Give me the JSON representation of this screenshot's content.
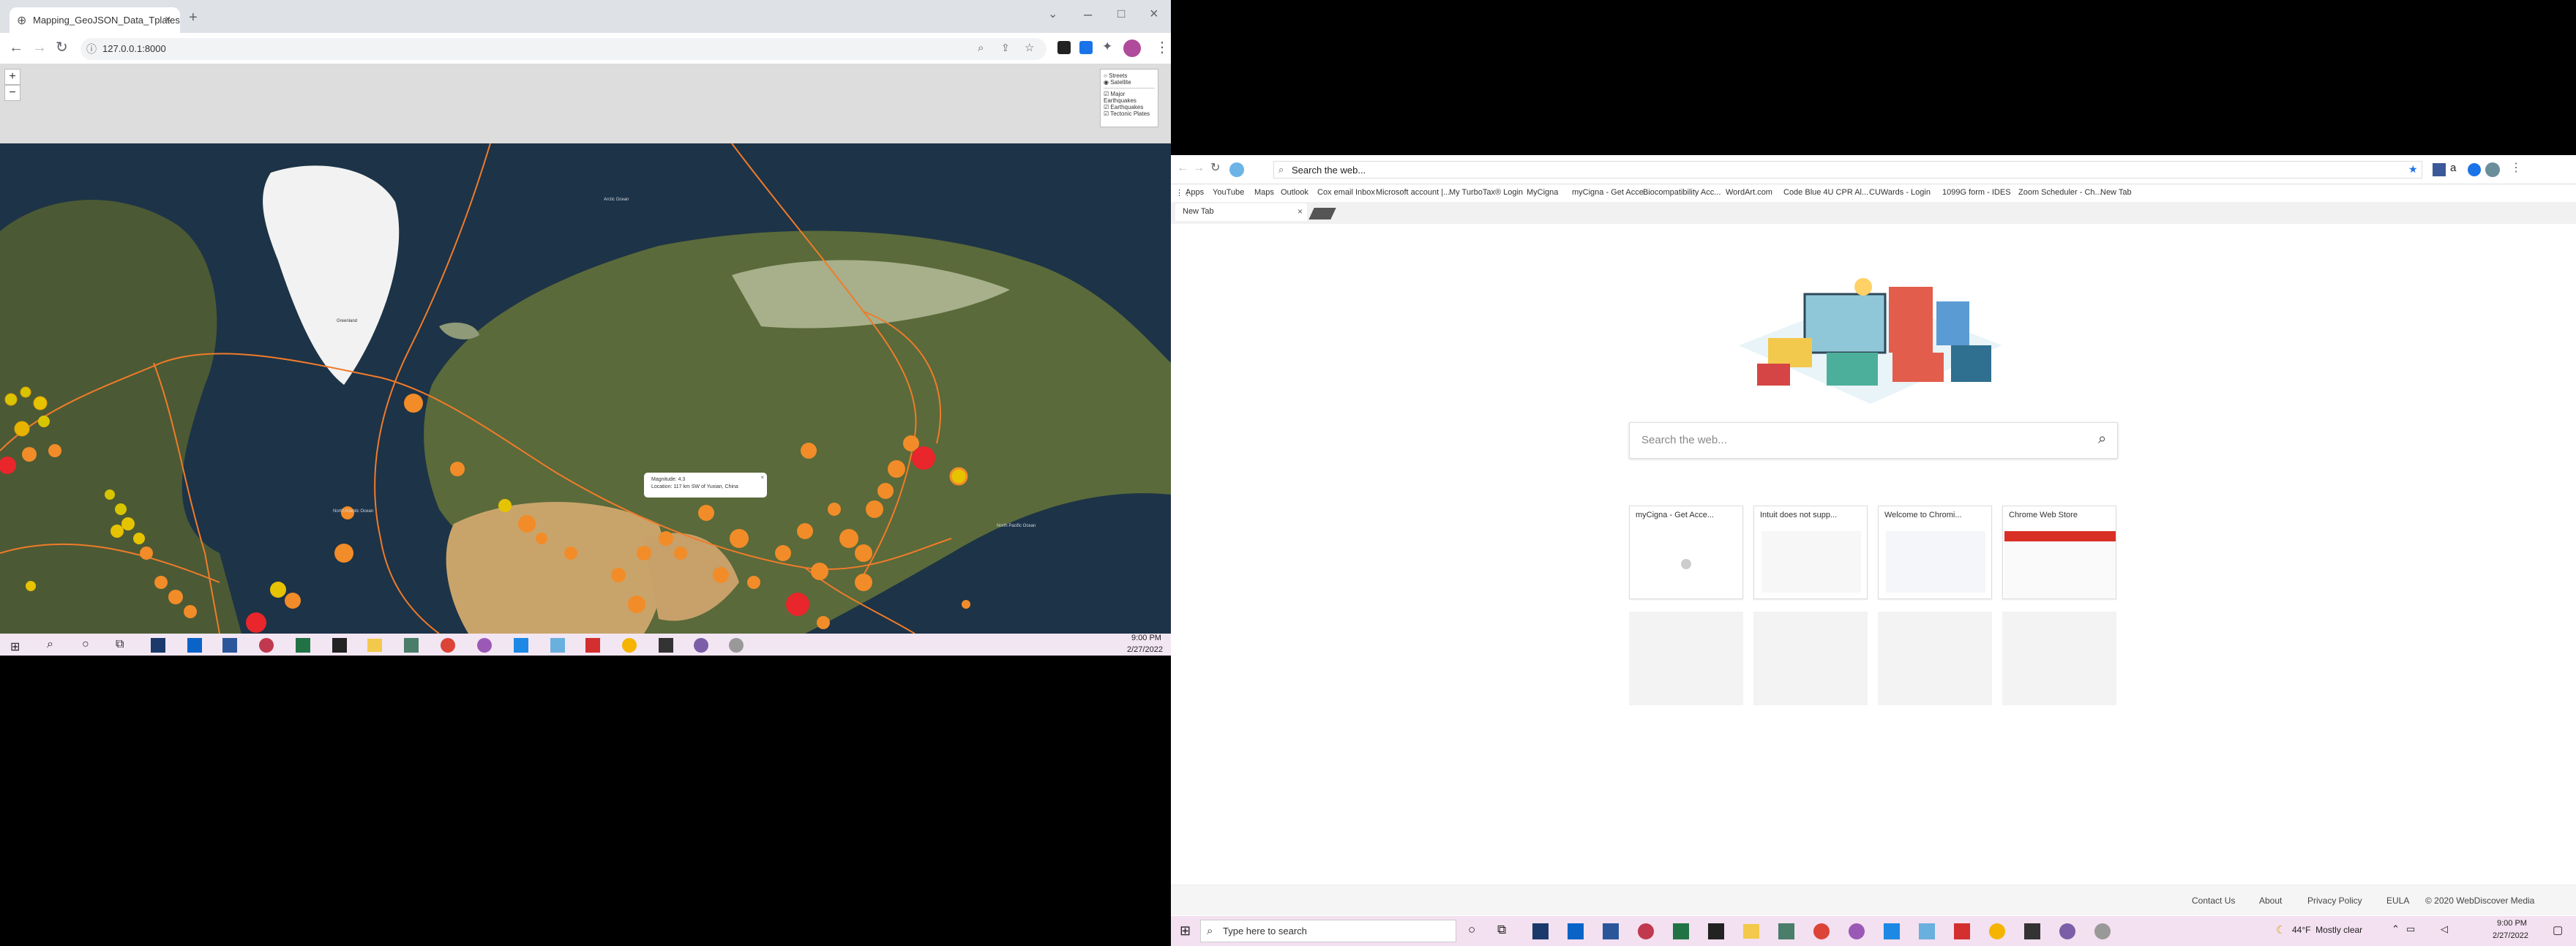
{
  "left": {
    "tab_title": "Mapping_GeoJSON_Data_Tplates",
    "url": "127.0.0.1:8000",
    "layers": {
      "base": [
        "Streets",
        "Satellite"
      ],
      "overlays": [
        "Major Earthquakes",
        "Earthquakes",
        "Tectonic Plates"
      ]
    },
    "map_labels": {
      "greenland": "Greenland",
      "arctic": "Arctic Ocean",
      "north_pacific": "North Pacific Ocean",
      "north_atlantic": "North Atlantic Ocean"
    },
    "popup": {
      "magnitude": "Magnitude: 4.3",
      "location": "Location: 117 km SW of Yuxian, China"
    },
    "taskbar": {
      "time": "9:00 PM",
      "date": "2/27/2022"
    }
  },
  "right": {
    "search_placeholder": "Search the web...",
    "address_placeholder": "Search the web...",
    "bookmarks": [
      "Apps",
      "YouTube",
      "Maps",
      "Outlook",
      "Cox email Inbox",
      "Microsoft account |...",
      "My TurboTax® Login",
      "MyCigna",
      "myCigna - Get Acce...",
      "Biocompatibility Acc...",
      "WordArt.com",
      "Code Blue 4U CPR Al...",
      "CUWards - Login",
      "1099G form - IDES",
      "Zoom Scheduler - Ch...",
      "New Tab"
    ],
    "tab": "New Tab",
    "tiles": [
      "myCigna - Get Acce...",
      "Intuit does not supp...",
      "Welcome to Chromi...",
      "Chrome Web Store"
    ],
    "footer": [
      "Contact Us",
      "About",
      "Privacy Policy",
      "EULA",
      "© 2020 WebDiscover Media"
    ],
    "taskbar": {
      "search": "Type here to search",
      "weather": "44°F  Mostly clear",
      "time": "9:00 PM",
      "date": "2/27/2022"
    }
  },
  "colors": {
    "plate_line": "#f07b2a",
    "quake_orange": "#f28c28",
    "quake_red": "#e8262b",
    "quake_yellow": "#d9c400"
  }
}
